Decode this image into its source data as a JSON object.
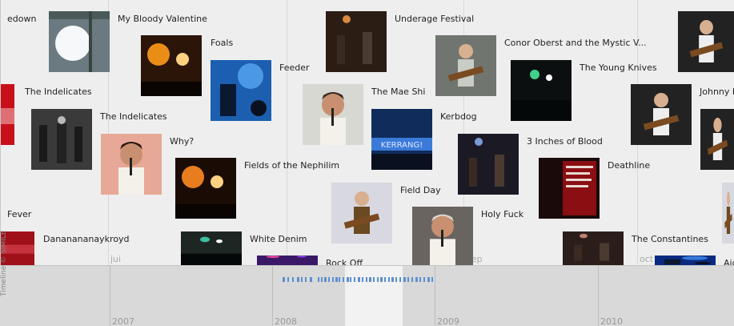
{
  "timeline": {
    "copyright": "Timeline © SIMILE",
    "months": [
      "jui",
      "sep",
      "oct"
    ],
    "years": [
      "2007",
      "2008",
      "2009",
      "2010"
    ],
    "events": [
      {
        "label": "edown",
        "thumb": "none",
        "bg": "#f4f4f4"
      },
      {
        "label": "My Bloody Valentine",
        "thumb": "bright-stage",
        "bg": "#6a7a80",
        "accent": "#ffffff"
      },
      {
        "label": "Foals",
        "thumb": "orange-stage",
        "bg": "#2a1508",
        "accent": "#ff9a1a"
      },
      {
        "label": "Feeder",
        "thumb": "blue-stage",
        "bg": "#1c5fb0",
        "accent": "#5fb0ff"
      },
      {
        "label": "Underage Festival",
        "thumb": "dark-band",
        "bg": "#2b1d14",
        "accent": "#d88a40"
      },
      {
        "label": "Conor Oberst and the Mystic V...",
        "thumb": "guitarist",
        "bg": "#707570",
        "accent": "#c9cbc5"
      },
      {
        "label": "The Young Knives",
        "thumb": "dark-green",
        "bg": "#0c0f10",
        "accent": "#3fd08a"
      },
      {
        "label": "The Indelicates",
        "thumb": "red-edge",
        "bg": "#c8101a",
        "accent": "#ffffff"
      },
      {
        "label": "The Indelicates",
        "thumb": "bw-band",
        "bg": "#3a3a3a",
        "accent": "#bbbbbb"
      },
      {
        "label": "The Mae Shi",
        "thumb": "singer",
        "bg": "#d8d8d2",
        "accent": "#3a2a24"
      },
      {
        "label": "Johnny F",
        "thumb": "guitarist",
        "bg": "#222222",
        "accent": "#eeeeee"
      },
      {
        "label": "Kerbdog",
        "thumb": "kerrang",
        "bg": "#102c5a",
        "accent": "#3b7ad8"
      },
      {
        "label": "3 Inches of Blood",
        "thumb": "dark-band",
        "bg": "#1b1a24",
        "accent": "#7a9ad8"
      },
      {
        "label": "Why?",
        "thumb": "singer",
        "bg": "#e8a898",
        "accent": "#2a1a10"
      },
      {
        "label": "Fields of the Nephilim",
        "thumb": "orange-stage",
        "bg": "#1a0c04",
        "accent": "#ff8a20"
      },
      {
        "label": "Deathline",
        "thumb": "red-poster",
        "bg": "#8a0e12",
        "accent": "#e8d8d0"
      },
      {
        "label": "Field Day",
        "thumb": "guitarist",
        "bg": "#d8d8e0",
        "accent": "#6a4a20"
      },
      {
        "label": "Fever",
        "thumb": "none",
        "bg": "#f4f4f4"
      },
      {
        "label": "Holy Fuck",
        "thumb": "singer",
        "bg": "#6a6460",
        "accent": "#e0d8d0"
      },
      {
        "label": "Dananananaykroyd",
        "thumb": "red-edge",
        "bg": "#a01018",
        "accent": "#ff6a7a"
      },
      {
        "label": "White Denim",
        "thumb": "dark-green",
        "bg": "#1e2624",
        "accent": "#3fc0a0"
      },
      {
        "label": "Rock Off",
        "thumb": "purple",
        "bg": "#3a1868",
        "accent": "#ff4a9a"
      },
      {
        "label": "The Constantines",
        "thumb": "dark-band",
        "bg": "#2b1e1a",
        "accent": "#c08070"
      },
      {
        "label": "Aid",
        "thumb": "blue-stage",
        "bg": "#0a2a80",
        "accent": "#4a9aff"
      }
    ]
  }
}
